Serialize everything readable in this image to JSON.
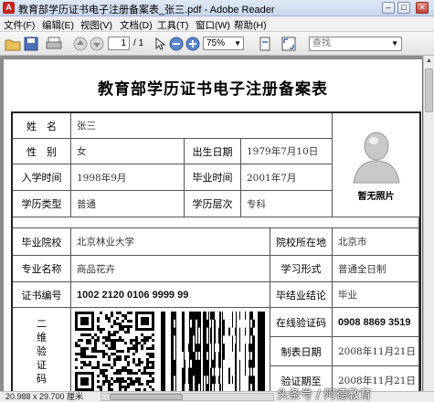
{
  "window": {
    "title": "教育部学历证书电子注册备案表_张三.pdf - Adobe Reader",
    "app_icon": "pdf-icon"
  },
  "menu": [
    "文件(F)",
    "编辑(E)",
    "视图(V)",
    "文档(D)",
    "工具(T)",
    "窗口(W)",
    "帮助(H)"
  ],
  "toolbar": {
    "page_current": "1",
    "page_total": "/ 1",
    "zoom": "75%",
    "search_placeholder": "查找"
  },
  "status": {
    "dimensions": "20.988 x 29.700 厘米"
  },
  "document": {
    "title": "教育部学历证书电子注册备案表",
    "rows": {
      "name_label": "姓　名",
      "name_value": "张三",
      "gender_label": "性　别",
      "gender_value": "女",
      "birth_label": "出生日期",
      "birth_value": "1979年7月10日",
      "enroll_label": "入学时间",
      "enroll_value": "1998年9月",
      "grad_label": "毕业时间",
      "grad_value": "2001年7月",
      "type_label": "学历类型",
      "type_value": "普通",
      "level_label": "学历层次",
      "level_value": "专科",
      "school_label": "毕业院校",
      "school_value": "北京林业大学",
      "location_label": "院校所在地",
      "location_value": "北京市",
      "major_label": "专业名称",
      "major_value": "商品花卉",
      "form_label": "学习形式",
      "form_value": "普通全日制",
      "cert_label": "证书编号",
      "cert_value": "1002 2120 0106 9999 99",
      "conclusion_label": "毕结业结论",
      "conclusion_value": "毕业",
      "qr_label": [
        "二",
        "维",
        "验",
        "证",
        "码"
      ],
      "verify_label": "在线验证码",
      "verify_value": "0908 8869 3519",
      "made_label": "制表日期",
      "made_value": "2008年11月21日",
      "expire_label": "验证期至",
      "expire_value": "2008年11月21日"
    },
    "photo_caption": "暂无照片"
  },
  "watermark": "头条号 / 阿德教育"
}
